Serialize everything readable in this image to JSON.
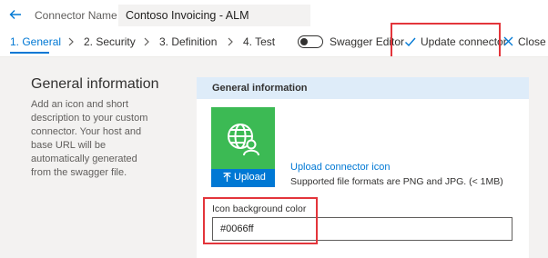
{
  "header": {
    "label": "Connector Name",
    "connector_name": "Contoso Invoicing - ALM"
  },
  "tabs": [
    {
      "label": "1. General",
      "active": true
    },
    {
      "label": "2. Security",
      "active": false
    },
    {
      "label": "3. Definition",
      "active": false
    },
    {
      "label": "4. Test",
      "active": false
    }
  ],
  "commands": {
    "swagger_editor_label": "Swagger Editor",
    "swagger_editor_on": false,
    "update_label": "Update connector",
    "close_label": "Close"
  },
  "general": {
    "title": "General information",
    "description": "Add an icon and short description to your custom connector. Your host and base URL will be automatically generated from the swagger file."
  },
  "card": {
    "header": "General information",
    "upload_button": "Upload",
    "upload_link": "Upload connector icon",
    "upload_hint": "Supported file formats are PNG and JPG. (< 1MB)",
    "color_label": "Icon background color",
    "color_value": "#0066ff"
  },
  "colors": {
    "accent": "#0078d4",
    "icon_tile": "#3cba54",
    "highlight": "#e3353b",
    "card_header": "#deecf9"
  },
  "icons": [
    "back-arrow-icon",
    "chevron-right-icon",
    "checkmark-icon",
    "close-icon",
    "globe-user-icon",
    "upload-arrow-icon"
  ]
}
